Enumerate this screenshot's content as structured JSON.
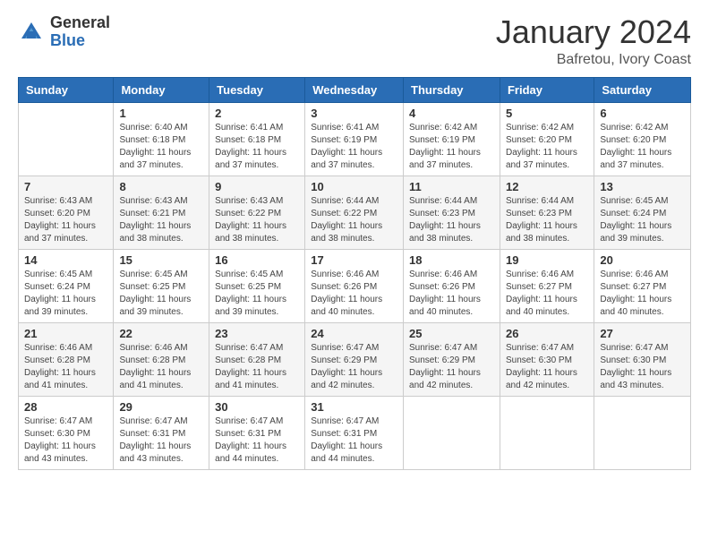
{
  "logo": {
    "general": "General",
    "blue": "Blue"
  },
  "header": {
    "month": "January 2024",
    "location": "Bafretou, Ivory Coast"
  },
  "days_of_week": [
    "Sunday",
    "Monday",
    "Tuesday",
    "Wednesday",
    "Thursday",
    "Friday",
    "Saturday"
  ],
  "weeks": [
    [
      {
        "day": "",
        "info": ""
      },
      {
        "day": "1",
        "info": "Sunrise: 6:40 AM\nSunset: 6:18 PM\nDaylight: 11 hours\nand 37 minutes."
      },
      {
        "day": "2",
        "info": "Sunrise: 6:41 AM\nSunset: 6:18 PM\nDaylight: 11 hours\nand 37 minutes."
      },
      {
        "day": "3",
        "info": "Sunrise: 6:41 AM\nSunset: 6:19 PM\nDaylight: 11 hours\nand 37 minutes."
      },
      {
        "day": "4",
        "info": "Sunrise: 6:42 AM\nSunset: 6:19 PM\nDaylight: 11 hours\nand 37 minutes."
      },
      {
        "day": "5",
        "info": "Sunrise: 6:42 AM\nSunset: 6:20 PM\nDaylight: 11 hours\nand 37 minutes."
      },
      {
        "day": "6",
        "info": "Sunrise: 6:42 AM\nSunset: 6:20 PM\nDaylight: 11 hours\nand 37 minutes."
      }
    ],
    [
      {
        "day": "7",
        "info": "Sunrise: 6:43 AM\nSunset: 6:20 PM\nDaylight: 11 hours\nand 37 minutes."
      },
      {
        "day": "8",
        "info": "Sunrise: 6:43 AM\nSunset: 6:21 PM\nDaylight: 11 hours\nand 38 minutes."
      },
      {
        "day": "9",
        "info": "Sunrise: 6:43 AM\nSunset: 6:22 PM\nDaylight: 11 hours\nand 38 minutes."
      },
      {
        "day": "10",
        "info": "Sunrise: 6:44 AM\nSunset: 6:22 PM\nDaylight: 11 hours\nand 38 minutes."
      },
      {
        "day": "11",
        "info": "Sunrise: 6:44 AM\nSunset: 6:23 PM\nDaylight: 11 hours\nand 38 minutes."
      },
      {
        "day": "12",
        "info": "Sunrise: 6:44 AM\nSunset: 6:23 PM\nDaylight: 11 hours\nand 38 minutes."
      },
      {
        "day": "13",
        "info": "Sunrise: 6:45 AM\nSunset: 6:24 PM\nDaylight: 11 hours\nand 39 minutes."
      }
    ],
    [
      {
        "day": "14",
        "info": "Sunrise: 6:45 AM\nSunset: 6:24 PM\nDaylight: 11 hours\nand 39 minutes."
      },
      {
        "day": "15",
        "info": "Sunrise: 6:45 AM\nSunset: 6:25 PM\nDaylight: 11 hours\nand 39 minutes."
      },
      {
        "day": "16",
        "info": "Sunrise: 6:45 AM\nSunset: 6:25 PM\nDaylight: 11 hours\nand 39 minutes."
      },
      {
        "day": "17",
        "info": "Sunrise: 6:46 AM\nSunset: 6:26 PM\nDaylight: 11 hours\nand 40 minutes."
      },
      {
        "day": "18",
        "info": "Sunrise: 6:46 AM\nSunset: 6:26 PM\nDaylight: 11 hours\nand 40 minutes."
      },
      {
        "day": "19",
        "info": "Sunrise: 6:46 AM\nSunset: 6:27 PM\nDaylight: 11 hours\nand 40 minutes."
      },
      {
        "day": "20",
        "info": "Sunrise: 6:46 AM\nSunset: 6:27 PM\nDaylight: 11 hours\nand 40 minutes."
      }
    ],
    [
      {
        "day": "21",
        "info": "Sunrise: 6:46 AM\nSunset: 6:28 PM\nDaylight: 11 hours\nand 41 minutes."
      },
      {
        "day": "22",
        "info": "Sunrise: 6:46 AM\nSunset: 6:28 PM\nDaylight: 11 hours\nand 41 minutes."
      },
      {
        "day": "23",
        "info": "Sunrise: 6:47 AM\nSunset: 6:28 PM\nDaylight: 11 hours\nand 41 minutes."
      },
      {
        "day": "24",
        "info": "Sunrise: 6:47 AM\nSunset: 6:29 PM\nDaylight: 11 hours\nand 42 minutes."
      },
      {
        "day": "25",
        "info": "Sunrise: 6:47 AM\nSunset: 6:29 PM\nDaylight: 11 hours\nand 42 minutes."
      },
      {
        "day": "26",
        "info": "Sunrise: 6:47 AM\nSunset: 6:30 PM\nDaylight: 11 hours\nand 42 minutes."
      },
      {
        "day": "27",
        "info": "Sunrise: 6:47 AM\nSunset: 6:30 PM\nDaylight: 11 hours\nand 43 minutes."
      }
    ],
    [
      {
        "day": "28",
        "info": "Sunrise: 6:47 AM\nSunset: 6:30 PM\nDaylight: 11 hours\nand 43 minutes."
      },
      {
        "day": "29",
        "info": "Sunrise: 6:47 AM\nSunset: 6:31 PM\nDaylight: 11 hours\nand 43 minutes."
      },
      {
        "day": "30",
        "info": "Sunrise: 6:47 AM\nSunset: 6:31 PM\nDaylight: 11 hours\nand 44 minutes."
      },
      {
        "day": "31",
        "info": "Sunrise: 6:47 AM\nSunset: 6:31 PM\nDaylight: 11 hours\nand 44 minutes."
      },
      {
        "day": "",
        "info": ""
      },
      {
        "day": "",
        "info": ""
      },
      {
        "day": "",
        "info": ""
      }
    ]
  ]
}
